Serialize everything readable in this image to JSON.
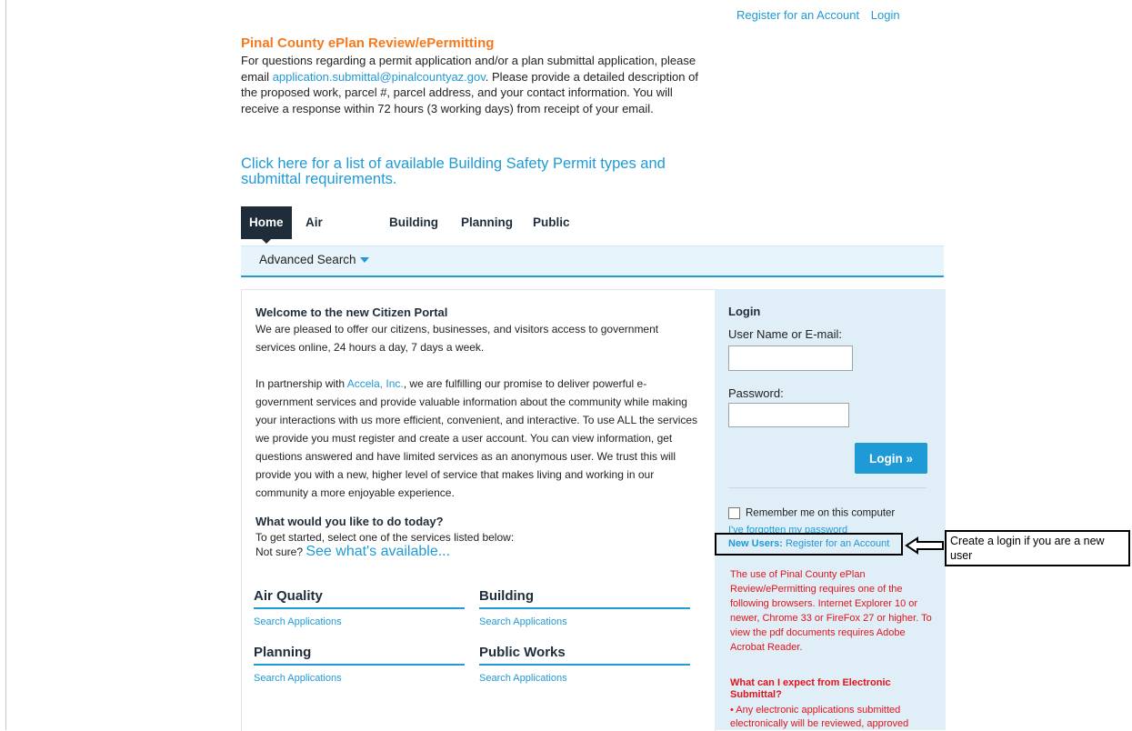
{
  "header": {
    "register_link": "Register for an Account",
    "login_link": "Login"
  },
  "intro": {
    "title": "Pinal County ePlan Review/ePermitting",
    "text_before": "For questions regarding a permit application and/or a plan submittal application, please email ",
    "email": "application.submittal@pinalcountyaz.gov",
    "text_after": ".  Please provide a detailed description of the proposed work, parcel #, parcel address, and your contact information.  You will receive a response within 72 hours (3 working days) from receipt of your email.",
    "permit_link": "Click here for a list of available Building Safety Permit types and submittal requirements."
  },
  "tabs": [
    {
      "label": "Home",
      "active": true
    },
    {
      "label": "Air Quality",
      "active": false
    },
    {
      "label": "Building",
      "active": false
    },
    {
      "label": "Planning",
      "active": false
    },
    {
      "label": "Public Works",
      "active": false
    }
  ],
  "subnav": {
    "advanced_search": "Advanced Search"
  },
  "welcome": {
    "title": "Welcome to the new Citizen Portal",
    "p1": "We are pleased to offer our citizens, businesses, and visitors access to government services online, 24 hours a day, 7 days a week.",
    "p2_before": "In partnership with ",
    "p2_link": "Accela, Inc.",
    "p2_after": ", we are fulfilling our promise to deliver powerful e-government services and provide valuable information about the community while making your interactions with us more efficient, convenient, and interactive. To use ALL the services we provide you must register and create a user account. You can view information, get questions answered and have limited services as an anonymous user. We trust this will provide you with a new, higher level of service that makes living and working in our community a more enjoyable experience."
  },
  "todo": {
    "title": "What would you like to do today?",
    "line1": "To get started, select one of the services listed below:",
    "not_sure": "Not sure? ",
    "see_available": "See what's available..."
  },
  "services": [
    {
      "title": "Air Quality",
      "link": "Search Applications"
    },
    {
      "title": "Building",
      "link": "Search Applications"
    },
    {
      "title": "Planning",
      "link": "Search Applications"
    },
    {
      "title": "Public Works",
      "link": "Search Applications"
    }
  ],
  "login": {
    "title": "Login",
    "username_label": "User Name or E-mail:",
    "username_value": "",
    "password_label": "Password:",
    "password_value": "",
    "button": "Login »",
    "remember": "Remember me on this computer",
    "forgot": "I've forgotten my password",
    "new_users_prefix": "New Users:",
    "new_users_link": "Register for an Account"
  },
  "callout": {
    "text": "Create a login if you are a new user"
  },
  "notice": {
    "text": "The use of Pinal County ePlan Review/ePermitting requires one of the following browsers. Internet Explorer 10 or newer, Chrome 33 or FireFox 27 or higher. To view the pdf documents requires Adobe Acrobat Reader.",
    "expect_title": "What can I expect from Electronic Submittal?",
    "expect_text": "• Any electronic applications submitted electronically will be reviewed, approved"
  },
  "colors": {
    "accent": "#1e9ad6",
    "title_orange": "#f47a20",
    "nav_dark": "#1f2d3a",
    "notice_red": "#e3141b",
    "login_panel_bg": "#dfeef7"
  }
}
